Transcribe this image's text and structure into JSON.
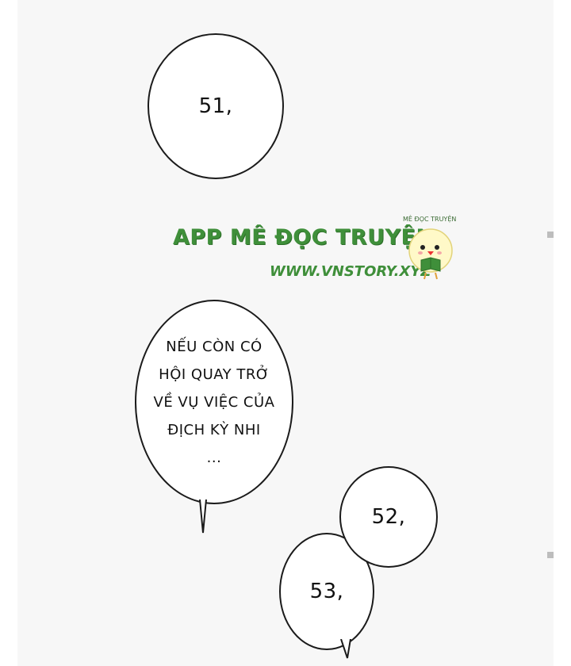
{
  "bubbles": {
    "b51": "51,",
    "b_long": "NẾU CÒN CÓ\nHỘI QUAY TRỞ\nVỀ VỤ VIỆC CỦA\nĐỊCH KỲ NHI\n...",
    "b52": "52,",
    "b53": "53,"
  },
  "watermark": {
    "title": "APP MÊ ĐỌC TRUYỆN",
    "url": "WWW.VNSTORY.XYZ",
    "small_label": "MÊ ĐỌC TRUYỆN",
    "color": "#3f8f3a",
    "mascot_icon": "chick-reading-icon"
  }
}
